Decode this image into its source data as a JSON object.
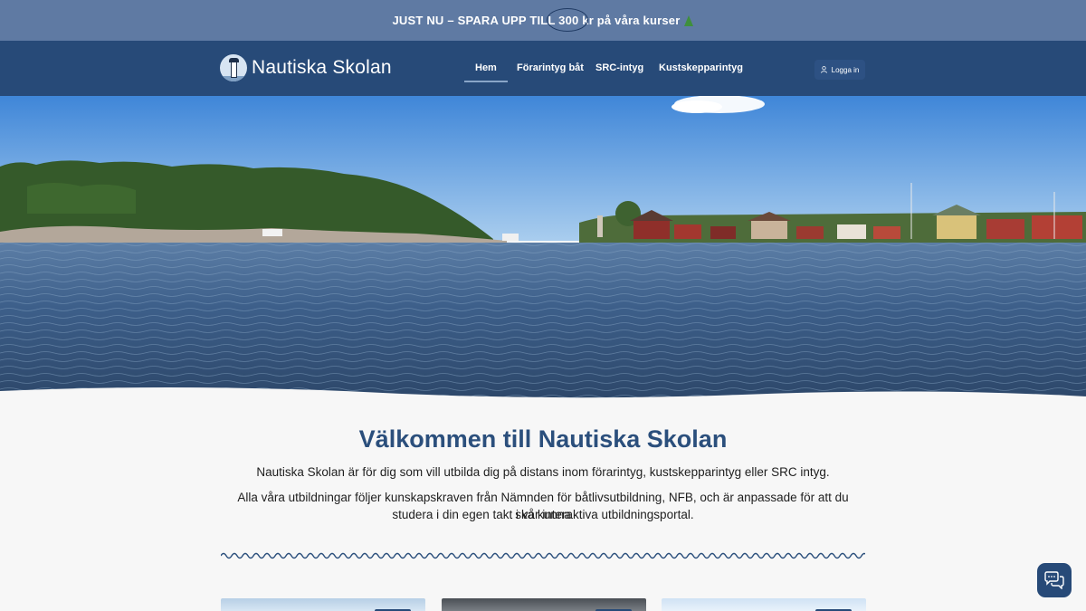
{
  "promo": {
    "text_before": "JUST NU – SPARA UPP TILL ",
    "highlight": "300",
    "text_after": " kr på våra kurser",
    "icon": "christmas-tree-icon"
  },
  "brand": {
    "name": "Nautiska Skolan",
    "logo_icon": "lighthouse-icon"
  },
  "nav": {
    "items": [
      {
        "label": "Hem",
        "active": true
      },
      {
        "label": "Förarintyg båt",
        "active": false
      },
      {
        "label": "SRC-intyg",
        "active": false
      },
      {
        "label": "Kustskepparintyg",
        "active": false
      }
    ],
    "login_label": "Logga in",
    "login_icon": "user-icon"
  },
  "hero": {
    "image": "archipelago-water-photo"
  },
  "main": {
    "title": "Välkommen till Nautiska Skolan",
    "paragraph1": "Nautiska Skolan är för dig som vill utbilda dig på distans inom förarintyg, kustskepparintyg eller SRC intyg.",
    "paragraph2_line1": "Alla våra utbildningar följer kunskapskraven från Nämnden för båtlivsutbildning, NFB, och är anpassade för att du ska kunna",
    "paragraph2_line2": "studera i din egen takt i vår interaktiva utbildningsportal."
  },
  "decor": {
    "divider_icon": "wave-divider-icon"
  },
  "cards": [
    {
      "image": "sky-photo"
    },
    {
      "image": "storm-photo"
    },
    {
      "image": "bright-sky-photo"
    }
  ],
  "chat": {
    "icon": "chat-bubbles-icon"
  },
  "colors": {
    "promo_bg": "#5f7aa3",
    "nav_bg": "#274a78",
    "title": "#2b4f7c",
    "page_bg": "#f7f7f7"
  }
}
